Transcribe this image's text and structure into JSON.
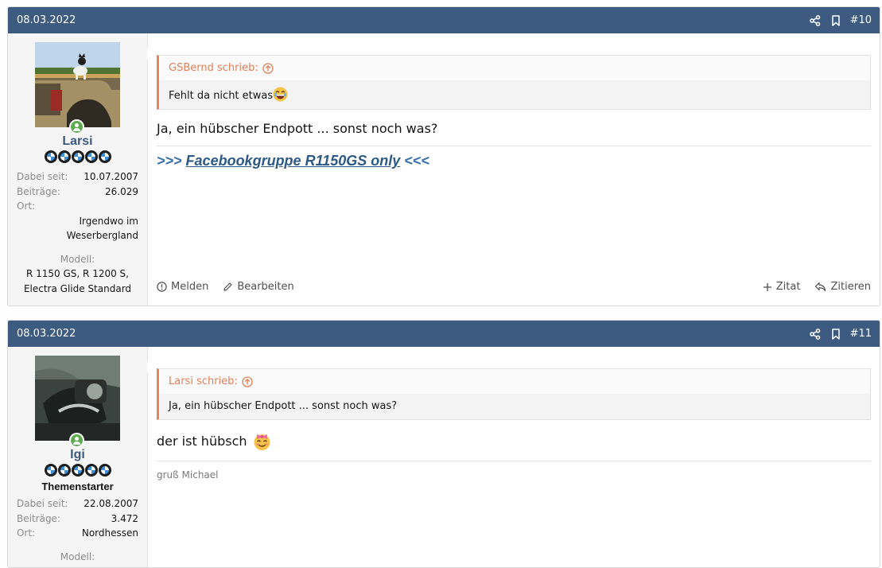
{
  "posts": [
    {
      "date": "08.03.2022",
      "number": "#10",
      "user": {
        "name": "Larsi",
        "stats": [
          {
            "label": "Dabei seit:",
            "value": "10.07.2007"
          },
          {
            "label": "Beiträge:",
            "value": "26.029"
          },
          {
            "label": "Ort:",
            "value": ""
          }
        ],
        "location": "Irgendwo im Weserbergland",
        "model_label": "Modell:",
        "model_value": "R 1150 GS, R 1200 S, Electra Glide Standard"
      },
      "quote": {
        "author": "GSBernd schrieb:",
        "text": "Fehlt da nicht etwas"
      },
      "message": "Ja, ein hübscher Endpott ... sonst noch was?",
      "signature": {
        "prefix": ">>> ",
        "link": "Facebookgruppe R1150GS only",
        "suffix": " <<<"
      },
      "actions": {
        "report": "Melden",
        "edit": "Bearbeiten",
        "quote_add": "Zitat",
        "reply": "Zitieren"
      }
    },
    {
      "date": "08.03.2022",
      "number": "#11",
      "user": {
        "name": "Igi",
        "badge": "Themenstarter",
        "stats": [
          {
            "label": "Dabei seit:",
            "value": "22.08.2007"
          },
          {
            "label": "Beiträge:",
            "value": "3.472"
          },
          {
            "label": "Ort:",
            "value": "Nordhessen"
          }
        ],
        "model_label": "Modell:"
      },
      "quote": {
        "author": "Larsi schrieb:",
        "text": "Ja, ein hübscher Endpott ... sonst noch was?"
      },
      "message": "der ist hübsch",
      "signature": {
        "text": "gruß Michael"
      }
    }
  ],
  "colors": {
    "header": "#3d5a80",
    "accent": "#e48458",
    "link": "#3870ad",
    "online": "#5cab4f"
  },
  "icons": [
    "share-icon",
    "bookmark-icon",
    "online-status-icon",
    "quote-arrow-icon",
    "laughing-emoji-icon",
    "bow-emoji-icon",
    "report-icon",
    "edit-icon",
    "plus-icon",
    "reply-icon"
  ]
}
